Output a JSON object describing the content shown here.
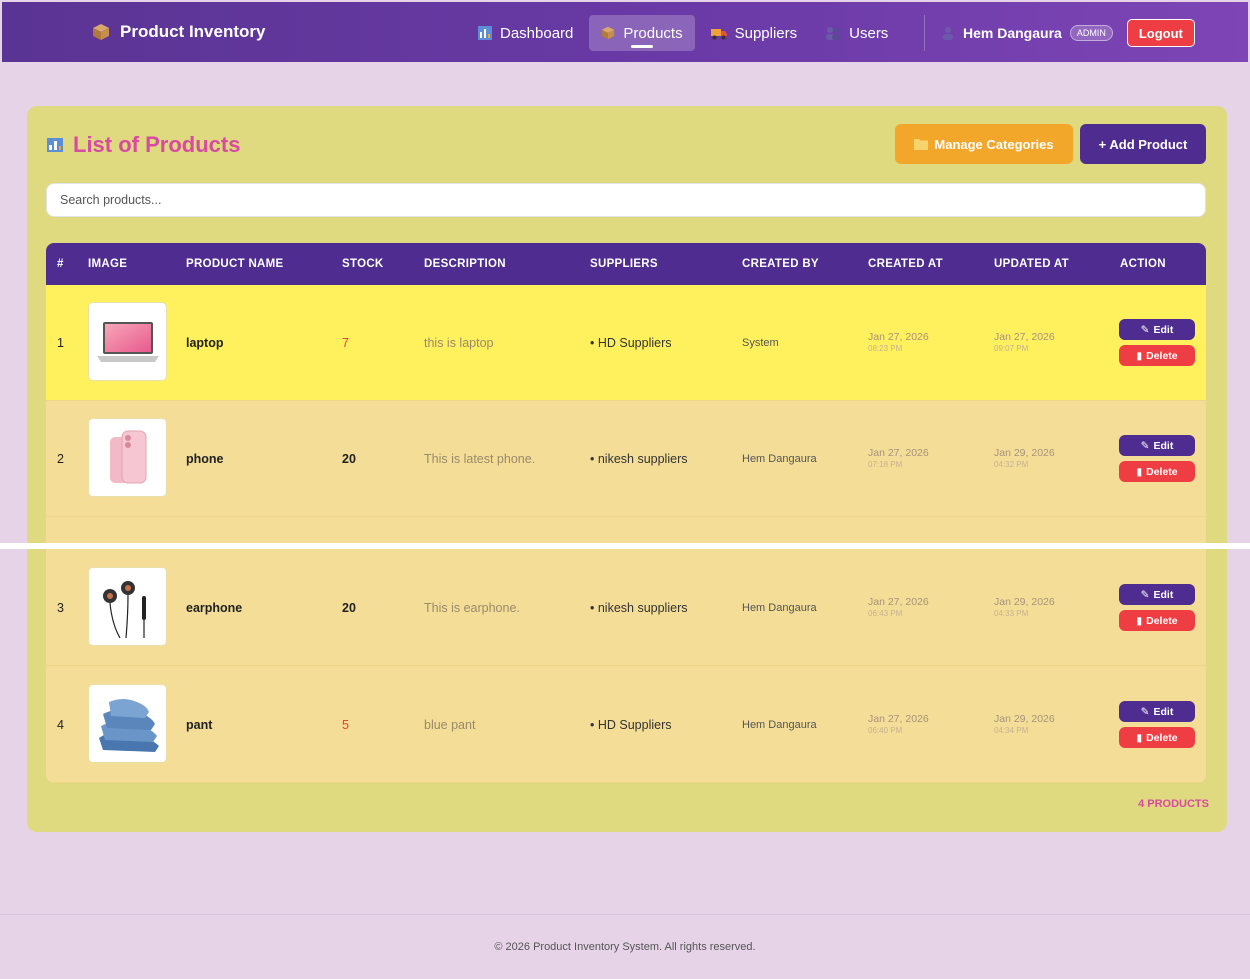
{
  "navbar": {
    "brand": "Product Inventory",
    "links": [
      {
        "label": "Dashboard",
        "icon": "chart-icon"
      },
      {
        "label": "Products",
        "icon": "box-icon",
        "active": true
      },
      {
        "label": "Suppliers",
        "icon": "truck-icon"
      },
      {
        "label": "Users",
        "icon": "users-icon"
      }
    ],
    "user": {
      "name": "Hem Dangaura",
      "role": "ADMIN"
    },
    "logout_label": "Logout"
  },
  "main": {
    "title": "List of Products",
    "manage_categories_label": "Manage Categories",
    "add_product_label": "+ Add Product",
    "search": {
      "placeholder": "Search products...",
      "value": ""
    },
    "table": {
      "headers": [
        "#",
        "IMAGE",
        "PRODUCT NAME",
        "STOCK",
        "DESCRIPTION",
        "SUPPLIERS",
        "CREATED BY",
        "CREATED AT",
        "UPDATED AT",
        "ACTION"
      ],
      "rows": [
        {
          "index": "1",
          "name": "laptop",
          "stock": "7",
          "description": "this is laptop",
          "supplier": "• HD Suppliers",
          "created_by": "System",
          "created_date": "Jan 27, 2026",
          "created_time": "08:23 PM",
          "updated_date": "Jan 27, 2026",
          "updated_time": "09:07 PM",
          "image": "laptop"
        },
        {
          "index": "2",
          "name": "phone",
          "stock": "20",
          "description": "This is latest phone.",
          "supplier": "• nikesh suppliers",
          "created_by": "Hem Dangaura",
          "created_date": "Jan 27, 2026",
          "created_time": "07:18 PM",
          "updated_date": "Jan 29, 2026",
          "updated_time": "04:32 PM",
          "image": "phone"
        },
        {
          "index": "3",
          "name": "earphone",
          "stock": "20",
          "description": "This is earphone.",
          "supplier": "• nikesh suppliers",
          "created_by": "Hem Dangaura",
          "created_date": "Jan 27, 2026",
          "created_time": "06:43 PM",
          "updated_date": "Jan 29, 2026",
          "updated_time": "04:33 PM",
          "image": "earphone"
        },
        {
          "index": "4",
          "name": "pant",
          "stock": "5",
          "description": "blue pant",
          "supplier": "• HD Suppliers",
          "created_by": "Hem Dangaura",
          "created_date": "Jan 27, 2026",
          "created_time": "06:40 PM",
          "updated_date": "Jan 29, 2026",
          "updated_time": "04:34 PM",
          "image": "pant"
        }
      ],
      "edit_label": "Edit",
      "delete_label": "Delete"
    },
    "count_label": "4 PRODUCTS"
  },
  "footer": {
    "text": "© 2026 Product Inventory System. All rights reserved."
  },
  "colors": {
    "primary": "#4f2c8f",
    "accent": "#d94aa2",
    "danger": "#ef3e43",
    "warning": "#f2a62a",
    "card": "#dfd97f",
    "highlight": "#fff05e"
  }
}
